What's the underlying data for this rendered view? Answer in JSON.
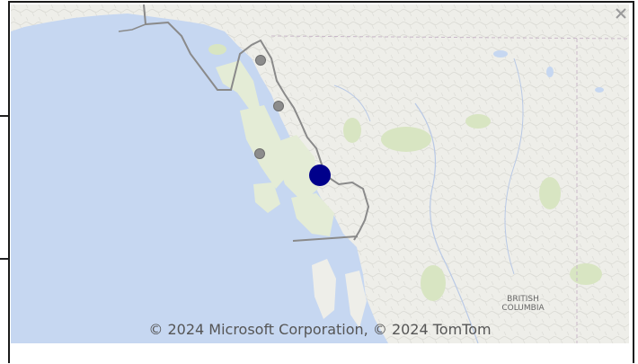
{
  "map": {
    "attribution": "© 2024 Microsoft Corporation, © 2024 TomTom",
    "region_label_line1": "BRITISH",
    "region_label_line2": "COLUMBIA",
    "colors": {
      "water": "#c6d7f1",
      "land": "#eeeee9",
      "forest": "#d8e5c2",
      "border": "#8a8a8a",
      "marker_primary": "#00008b",
      "marker_secondary": "#8c8c8c"
    },
    "markers": [
      {
        "type": "secondary"
      },
      {
        "type": "secondary"
      },
      {
        "type": "secondary"
      },
      {
        "type": "primary"
      }
    ]
  },
  "controls": {
    "close_icon": "close-icon"
  }
}
